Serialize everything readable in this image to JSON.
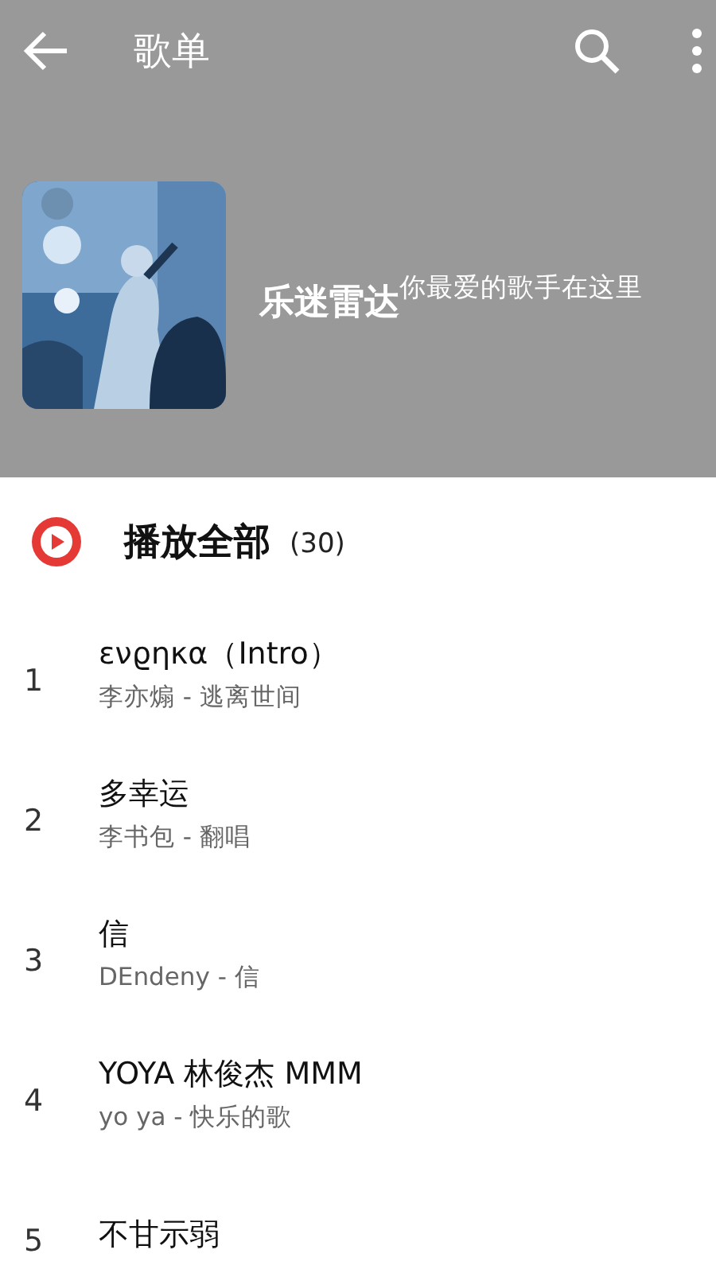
{
  "app_bar": {
    "title": "歌单"
  },
  "playlist": {
    "title": "乐迷雷达",
    "subtitle": "你最爱的歌手在这里"
  },
  "play_all": {
    "label": "播放全部",
    "count": "(30)"
  },
  "songs": [
    {
      "index": "1",
      "title": "ενϱηκα（Intro）",
      "subtitle": "李亦煽 - 逃离世间"
    },
    {
      "index": "2",
      "title": "多幸运",
      "subtitle": "李书包 - 翻唱"
    },
    {
      "index": "3",
      "title": "信",
      "subtitle": "DEndeny - 信"
    },
    {
      "index": "4",
      "title": "YOYA 林俊杰 MMM",
      "subtitle": "yo ya - 快乐的歌"
    },
    {
      "index": "5",
      "title": "不甘示弱"
    }
  ]
}
